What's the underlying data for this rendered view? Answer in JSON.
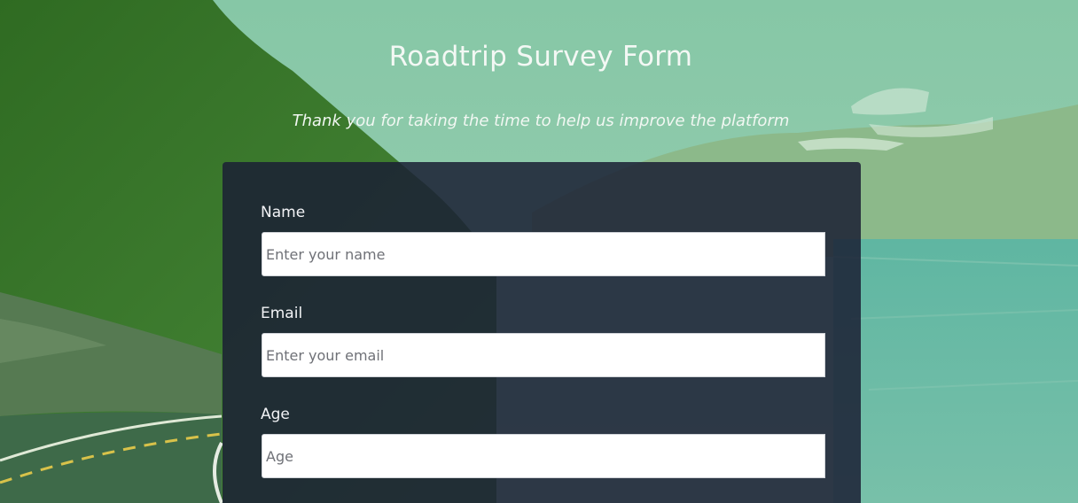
{
  "form": {
    "title": "Roadtrip Survey Form",
    "subtitle": "Thank you for taking the time to help us improve the platform",
    "fields": [
      {
        "label": "Name",
        "placeholder": "Enter your name",
        "value": ""
      },
      {
        "label": "Email",
        "placeholder": "Enter your email",
        "value": ""
      },
      {
        "label": "Age",
        "placeholder": "Age",
        "value": ""
      }
    ]
  },
  "colors": {
    "card_background": "#1b2034",
    "overlay_tint": "#7fb69a",
    "text_light": "#f3f8f4"
  },
  "background": {
    "icon": "roadtrip-landscape-photo"
  }
}
